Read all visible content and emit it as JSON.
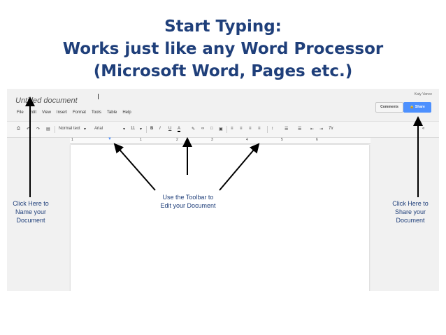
{
  "heading": {
    "line1": "Start Typing:",
    "line2": "Works just like any Word Processor",
    "line3": "(Microsoft Word, Pages etc.)"
  },
  "app": {
    "doc_title": "Untitled document",
    "user_name": "Katy Vance",
    "comments_label": "Comments",
    "share_label": "Share",
    "menu": [
      "File",
      "Edit",
      "View",
      "Insert",
      "Format",
      "Tools",
      "Table",
      "Help"
    ],
    "toolbar": {
      "style_value": "Normal text",
      "font_value": "Arial",
      "size_value": "11",
      "bold": "B",
      "italic": "I",
      "underline": "U",
      "text_color": "A",
      "clear_format": "Tx",
      "collapse": "«"
    },
    "ruler_numbers": [
      "1",
      "1",
      "2",
      "3",
      "4",
      "5",
      "6"
    ]
  },
  "annotations": {
    "name_doc": [
      "Click Here to",
      "Name your",
      "Document"
    ],
    "toolbar": [
      "Use the Toolbar to",
      "Edit your Document"
    ],
    "share": [
      "Click Here to",
      "Share your",
      "Document"
    ]
  },
  "colors": {
    "heading": "#1f3f7a",
    "share_button": "#4d90fe",
    "arrow": "#000000"
  }
}
